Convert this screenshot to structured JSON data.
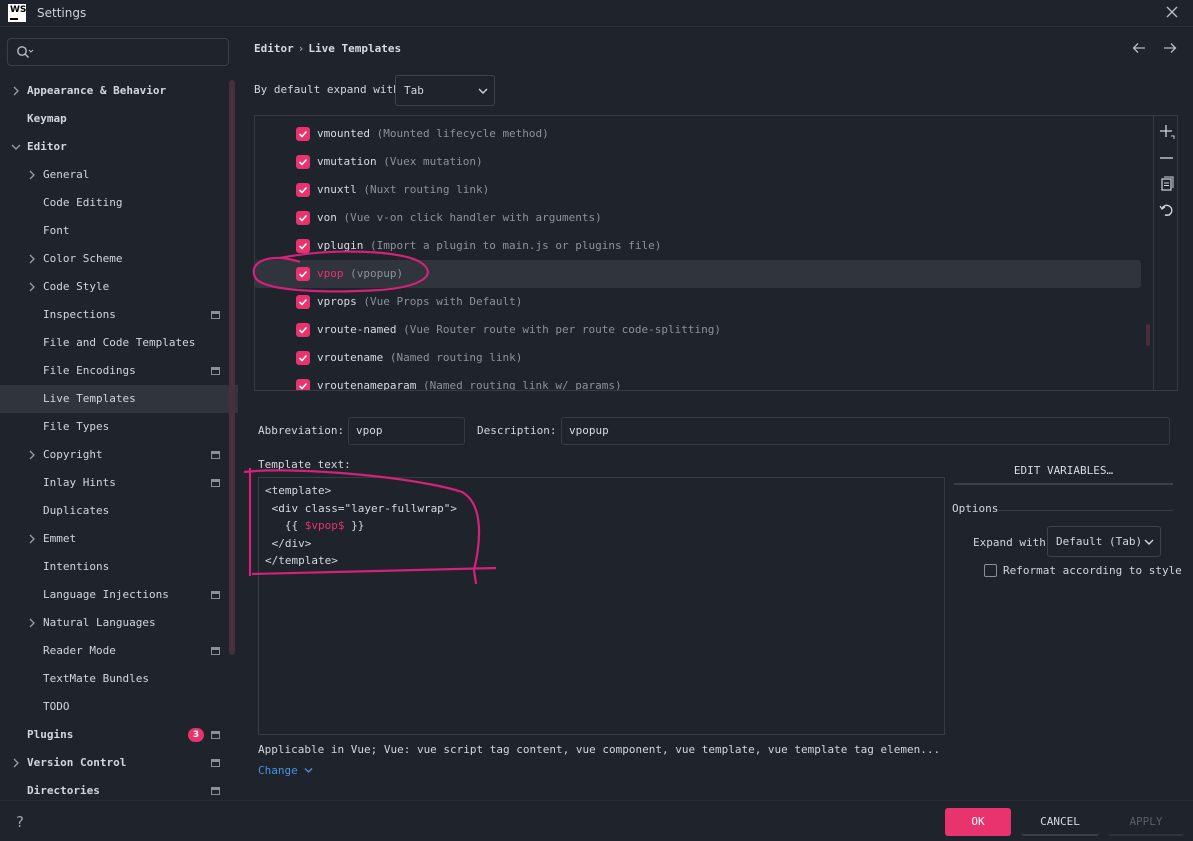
{
  "window": {
    "title": "Settings",
    "logo": "WS"
  },
  "colors": {
    "accent": "#e8336e",
    "link": "#4a90e2",
    "annotation": "#d4217a"
  },
  "sidebar": {
    "search_placeholder": "",
    "items": [
      {
        "label": "Appearance & Behavior",
        "level": 0,
        "chevron": "right",
        "bold": true
      },
      {
        "label": "Keymap",
        "level": 0,
        "chevron": "none",
        "bold": true
      },
      {
        "label": "Editor",
        "level": 0,
        "chevron": "down",
        "bold": true
      },
      {
        "label": "General",
        "level": 1,
        "chevron": "right"
      },
      {
        "label": "Code Editing",
        "level": 1,
        "chevron": "none"
      },
      {
        "label": "Font",
        "level": 1,
        "chevron": "none"
      },
      {
        "label": "Color Scheme",
        "level": 1,
        "chevron": "right"
      },
      {
        "label": "Code Style",
        "level": 1,
        "chevron": "right"
      },
      {
        "label": "Inspections",
        "level": 1,
        "chevron": "none",
        "project_icon": true
      },
      {
        "label": "File and Code Templates",
        "level": 1,
        "chevron": "none"
      },
      {
        "label": "File Encodings",
        "level": 1,
        "chevron": "none",
        "project_icon": true
      },
      {
        "label": "Live Templates",
        "level": 1,
        "chevron": "none",
        "selected": true
      },
      {
        "label": "File Types",
        "level": 1,
        "chevron": "none"
      },
      {
        "label": "Copyright",
        "level": 1,
        "chevron": "right",
        "project_icon": true
      },
      {
        "label": "Inlay Hints",
        "level": 1,
        "chevron": "none",
        "project_icon": true
      },
      {
        "label": "Duplicates",
        "level": 1,
        "chevron": "none"
      },
      {
        "label": "Emmet",
        "level": 1,
        "chevron": "right"
      },
      {
        "label": "Intentions",
        "level": 1,
        "chevron": "none"
      },
      {
        "label": "Language Injections",
        "level": 1,
        "chevron": "none",
        "project_icon": true
      },
      {
        "label": "Natural Languages",
        "level": 1,
        "chevron": "right"
      },
      {
        "label": "Reader Mode",
        "level": 1,
        "chevron": "none",
        "project_icon": true
      },
      {
        "label": "TextMate Bundles",
        "level": 1,
        "chevron": "none"
      },
      {
        "label": "TODO",
        "level": 1,
        "chevron": "none"
      },
      {
        "label": "Plugins",
        "level": 0,
        "chevron": "none",
        "bold": true,
        "badge": "3",
        "project_icon": true
      },
      {
        "label": "Version Control",
        "level": 0,
        "chevron": "right",
        "bold": true,
        "project_icon": true
      },
      {
        "label": "Directories",
        "level": 0,
        "chevron": "none",
        "bold": true,
        "project_icon": true
      }
    ]
  },
  "main": {
    "breadcrumb": {
      "parent": "Editor",
      "separator": "›",
      "current": "Live Templates"
    },
    "expand_with": {
      "label": "By default expand with",
      "value": "Tab"
    },
    "templates": [
      {
        "name": "vmounted",
        "desc": "(Mounted lifecycle method)"
      },
      {
        "name": "vmutation",
        "desc": "(Vuex mutation)"
      },
      {
        "name": "vnuxtl",
        "desc": "(Nuxt routing link)"
      },
      {
        "name": "von",
        "desc": "(Vue v-on click handler with arguments)"
      },
      {
        "name": "vplugin",
        "desc": "(Import a plugin to main.js or plugins file)"
      },
      {
        "name": "vpop",
        "desc": "(vpopup)",
        "selected": true
      },
      {
        "name": "vprops",
        "desc": "(Vue Props with Default)"
      },
      {
        "name": "vroute-named",
        "desc": "(Vue Router route with per route code-splitting)"
      },
      {
        "name": "vroutename",
        "desc": "(Named routing link)"
      },
      {
        "name": "vroutenameparam",
        "desc": "(Named routing link w/ params)"
      }
    ],
    "abbreviation": {
      "label": "Abbreviation:",
      "value": "vpop"
    },
    "description": {
      "label": "Description:",
      "value": "vpopup"
    },
    "template_text_label": "Template text:",
    "template_code": {
      "l1": "<template>",
      "l2": " <div class=\"layer-fullwrap\">",
      "l3_pre": "   {{ ",
      "l3_var": "$vpop$",
      "l3_post": " }}",
      "l4": " </div>",
      "l5": "</template>"
    },
    "edit_variables": "EDIT VARIABLES…",
    "options": {
      "title": "Options",
      "expand_label": "Expand with",
      "expand_value": "Default (Tab)",
      "reformat_label": "Reformat according to style"
    },
    "applicable": "Applicable in Vue; Vue: vue script tag content, vue component, vue template, vue template tag elemen...",
    "change_link": "Change"
  },
  "footer": {
    "help": "?",
    "ok": "OK",
    "cancel": "CANCEL",
    "apply": "APPLY"
  }
}
